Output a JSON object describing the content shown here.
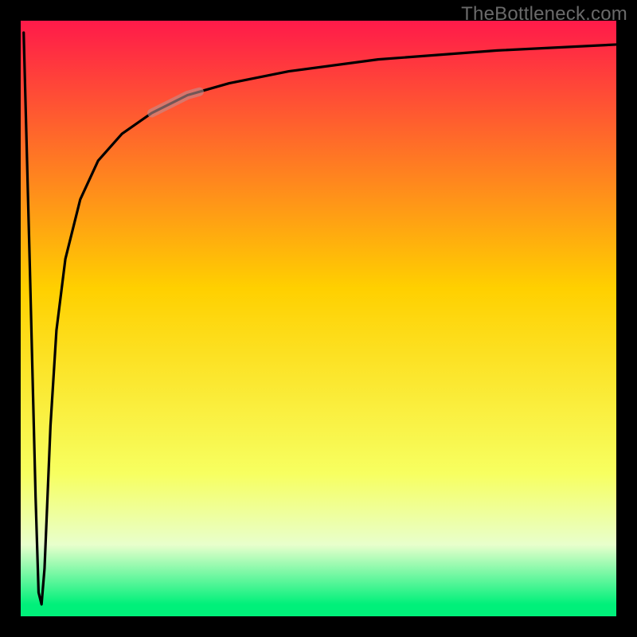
{
  "watermark": "TheBottleneck.com",
  "colors": {
    "frame": "#000000",
    "grad_top": "#ff1a4a",
    "grad_mid": "#ffd000",
    "grad_low1": "#f7ff60",
    "grad_low2": "#e8ffcc",
    "grad_green": "#00f07a",
    "curve": "#000000",
    "segment": "#c09090"
  },
  "frame": {
    "outer_w": 800,
    "outer_h": 800,
    "border": 26,
    "inner_x": 26,
    "inner_y": 26,
    "inner_w": 748,
    "inner_h": 748
  },
  "chart_data": {
    "type": "line",
    "title": "",
    "xlabel": "",
    "ylabel": "",
    "xlim": [
      0,
      100
    ],
    "ylim": [
      0,
      100
    ],
    "x": [
      0.5,
      1.5,
      2.5,
      3.0,
      3.5,
      4.0,
      4.5,
      5.0,
      6.0,
      7.5,
      10.0,
      13.0,
      17.0,
      22.0,
      28.0,
      35.0,
      45.0,
      60.0,
      80.0,
      100.0
    ],
    "values": [
      98,
      60,
      20,
      4,
      2,
      8,
      20,
      32,
      48,
      60,
      70,
      76.5,
      81,
      84.5,
      87.5,
      89.5,
      91.5,
      93.5,
      95.0,
      96.0
    ],
    "highlight_segment": {
      "x0": 22.0,
      "x1": 30.0
    },
    "gradient_stops_pct": [
      {
        "offset": 0,
        "role": "top"
      },
      {
        "offset": 45,
        "role": "mid"
      },
      {
        "offset": 76,
        "role": "low1"
      },
      {
        "offset": 88,
        "role": "low2"
      },
      {
        "offset": 98,
        "role": "green"
      },
      {
        "offset": 100,
        "role": "green"
      }
    ]
  }
}
